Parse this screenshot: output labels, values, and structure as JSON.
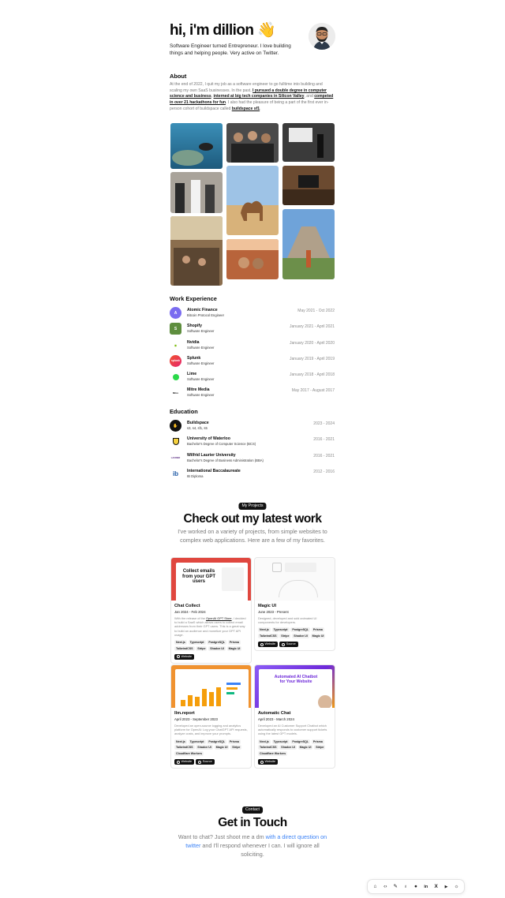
{
  "hero": {
    "title": "hi, i'm dillion 👋",
    "subtitle": "Software Engineer turned Entrepreneur. I love building things and helping people. Very active on Twitter."
  },
  "about": {
    "heading": "About",
    "t1": "At the end of 2022, I quit my job as a software engineer to go fulltime into building and scaling my own SaaS businesses. In the past, ",
    "l1": "I pursued a double degree in computer science and business",
    "t2": ", ",
    "l2": "interned at big tech companies in Silicon Valley",
    "t3": ", and ",
    "l3": "competed in over 21 hackathons for fun",
    "t4": ". I also had the pleasure of being a part of the first ever in-person cohort of buildspace called ",
    "l4": "buildspace sf1",
    "t5": "."
  },
  "work": {
    "heading": "Work Experience",
    "items": [
      {
        "company": "Atomic Finance",
        "role": "Bitcoin Protocol Engineer",
        "dates": "May 2021 - Oct 2022",
        "color": "#7a6cf0"
      },
      {
        "company": "Shopify",
        "role": "Software Engineer",
        "dates": "January 2021 - April 2021",
        "color": "#5e8e3e"
      },
      {
        "company": "Nvidia",
        "role": "Software Engineer",
        "dates": "January 2020 - April 2020",
        "color": "#76b900"
      },
      {
        "company": "Splunk",
        "role": "Software Engineer",
        "dates": "January 2019 - April 2019",
        "color": "#f0522d"
      },
      {
        "company": "Lime",
        "role": "Software Engineer",
        "dates": "January 2018 - April 2018",
        "color": "#2bd94a"
      },
      {
        "company": "Mitre Media",
        "role": "Software Engineer",
        "dates": "May 2017 - August 2017",
        "color": "#ffffff"
      }
    ]
  },
  "education": {
    "heading": "Education",
    "items": [
      {
        "school": "Buildspace",
        "degree": "s3, s4, sf1, s5",
        "dates": "2023 - 2024",
        "color": "#111111"
      },
      {
        "school": "University of Waterloo",
        "degree": "Bachelor's Degree of Computer Science (BCS)",
        "dates": "2016 - 2021",
        "color": "#f4d03f"
      },
      {
        "school": "Wilfrid Laurier University",
        "degree": "Bachelor's Degree of Business Administration (BBA)",
        "dates": "2016 - 2021",
        "color": "#5b2c83"
      },
      {
        "school": "International Baccalaureate",
        "degree": "IB Diploma",
        "dates": "2012 - 2016",
        "color": "#1f5aa6"
      }
    ]
  },
  "projects": {
    "pill": "My Projects",
    "title": "Check out my latest work",
    "subtitle": "I've worked on a variety of projects, from simple websites to complex web applications. Here are a few of my favorites.",
    "cards": [
      {
        "title": "Chat Collect",
        "dates": "Jan 2024 - Feb 2024",
        "desc_a": "With the release of the ",
        "desc_link": "OpenAI GPT Store",
        "desc_b": ", I decided to build a SaaS which allows users to collect email addresses from their GPT users. This is a great way to build an audience and monetize your GPT API usage.",
        "thumb_text": "Collect emails from your GPT users",
        "tags": [
          "Next.js",
          "Typescript",
          "PostgreSQL",
          "Prisma",
          "TailwindCSS",
          "Stripe",
          "Shadcn UI",
          "Magic UI"
        ],
        "links": [
          "Website"
        ]
      },
      {
        "title": "Magic UI",
        "dates": "June 2023 - Present",
        "desc_a": "Designed, developed and sold animated UI components for developers.",
        "desc_link": "",
        "desc_b": "",
        "thumb_text": "",
        "tags": [
          "Next.js",
          "Typescript",
          "PostgreSQL",
          "Prisma",
          "TailwindCSS",
          "Stripe",
          "Shadcn UI",
          "Magic UI"
        ],
        "links": [
          "Website",
          "Source"
        ]
      },
      {
        "title": "llm.report",
        "dates": "April 2023 - September 2023",
        "desc_a": "Developed an open-source logging and analytics platform for OpenAI: Log your ChatGPT API requests, analyze costs, and improve your prompts.",
        "desc_link": "",
        "desc_b": "",
        "thumb_text": "",
        "tags": [
          "Next.js",
          "Typescript",
          "PostgreSQL",
          "Prisma",
          "TailwindCSS",
          "Shadcn UI",
          "Magic UI",
          "Stripe",
          "Cloudflare Workers"
        ],
        "links": [
          "Website",
          "Source"
        ]
      },
      {
        "title": "Automatic Chat",
        "dates": "April 2023 - March 2024",
        "desc_a": "Developed an AI Customer Support Chatbot which automatically responds to customer support tickets using the latest GPT models.",
        "desc_link": "",
        "desc_b": "",
        "thumb_text": "Automated AI Chatbot for Your Website",
        "tags": [
          "Next.js",
          "Typescript",
          "PostgreSQL",
          "Prisma",
          "TailwindCSS",
          "Shadcn UI",
          "Magic UI",
          "Stripe",
          "Cloudflare Workers"
        ],
        "links": [
          "Website"
        ]
      }
    ]
  },
  "contact": {
    "pill": "Contact",
    "title": "Get in Touch",
    "text_a": "Want to chat? Just shoot me a dm ",
    "link": "with a direct question on twitter",
    "text_b": " and I'll respond whenever I can. I will ignore all soliciting."
  },
  "dock": {
    "icons": [
      "home-icon",
      "code-icon",
      "pencil-icon",
      "bulb-icon",
      "github-icon",
      "linkedin-icon",
      "x-icon",
      "youtube-icon",
      "sun-icon"
    ],
    "glyphs": [
      "⌂",
      "‹›",
      "✎",
      "♁",
      "●",
      "in",
      "X",
      "▶",
      "☼"
    ]
  }
}
